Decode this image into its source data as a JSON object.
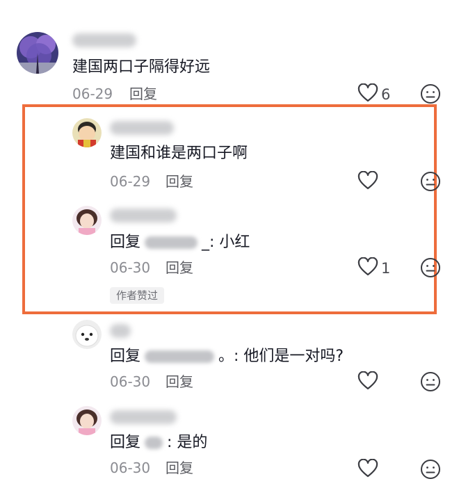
{
  "comments": [
    {
      "text": "建国两口子隔得好远",
      "date": "06-29",
      "reply_label": "回复",
      "like_count": "6"
    }
  ],
  "replies": [
    {
      "text": "建国和谁是两口子啊",
      "date": "06-29",
      "reply_label": "回复",
      "like_count": ""
    },
    {
      "prefix": "回复",
      "suffix": "_: 小红",
      "date": "06-30",
      "reply_label": "回复",
      "like_count": "1",
      "badge": "作者赞过"
    },
    {
      "prefix": "回复",
      "suffix": "。: 他们是一对吗?",
      "date": "06-30",
      "reply_label": "回复",
      "like_count": ""
    },
    {
      "prefix": "回复",
      "suffix": ": 是的",
      "date": "06-30",
      "reply_label": "回复",
      "like_count": ""
    }
  ],
  "colors": {
    "highlight": "#ee6d3c",
    "muted": "#8a8b91"
  },
  "icons": {
    "like": "heart-outline-icon",
    "emoji": "emoji-face-icon"
  }
}
